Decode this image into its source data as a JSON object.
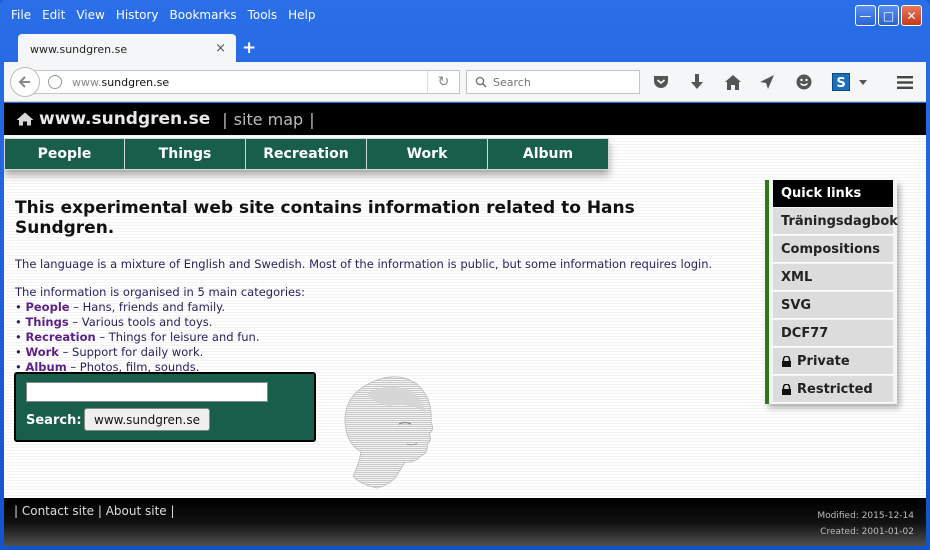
{
  "menubar": {
    "items": [
      "File",
      "Edit",
      "View",
      "History",
      "Bookmarks",
      "Tools",
      "Help"
    ]
  },
  "window_controls": {
    "minimize": "—",
    "maximize": "□",
    "close": "✕"
  },
  "tab": {
    "title": "www.sundgren.se",
    "close": "×",
    "new_tab": "+"
  },
  "navbar": {
    "url_prefix": "www.",
    "url_host": "sundgren.se",
    "search_placeholder": "Search",
    "reload": "↻"
  },
  "site": {
    "title": "www.sundgren.se",
    "separator": "|",
    "sitemap": "site map",
    "sitemap_suffix": "|"
  },
  "nav_tabs": [
    "People",
    "Things",
    "Recreation",
    "Work",
    "Album"
  ],
  "content": {
    "headline": "This experimental web site contains information related to Hans Sundgren.",
    "intro": "The language is a mixture of English and Swedish. Most of the information is public, but some information requires login.",
    "categories_intro": "The information is organised in 5 main categories:",
    "categories": [
      {
        "name": "People",
        "desc": " – Hans, friends and family."
      },
      {
        "name": "Things",
        "desc": " – Various tools and toys."
      },
      {
        "name": "Recreation",
        "desc": " – Things for leisure and fun."
      },
      {
        "name": "Work",
        "desc": " – Support for daily work."
      },
      {
        "name": "Album",
        "desc": " – Photos, film, sounds."
      }
    ],
    "bullet": "• "
  },
  "search": {
    "label": "Search:",
    "button": "www.sundgren.se",
    "value": ""
  },
  "quick_links": {
    "title": "Quick links",
    "items": [
      "Träningsdagbok",
      "Compositions",
      "XML",
      "SVG",
      "DCF77",
      "Private",
      "Restricted"
    ]
  },
  "footer": {
    "links": "| Contact site | About site |",
    "modified": "Modified: 2015-12-14",
    "created": "Created: 2001-01-02"
  },
  "colors": {
    "accent_green": "#195e4b",
    "link_purple": "#5b1f86",
    "header_black": "#000000"
  }
}
